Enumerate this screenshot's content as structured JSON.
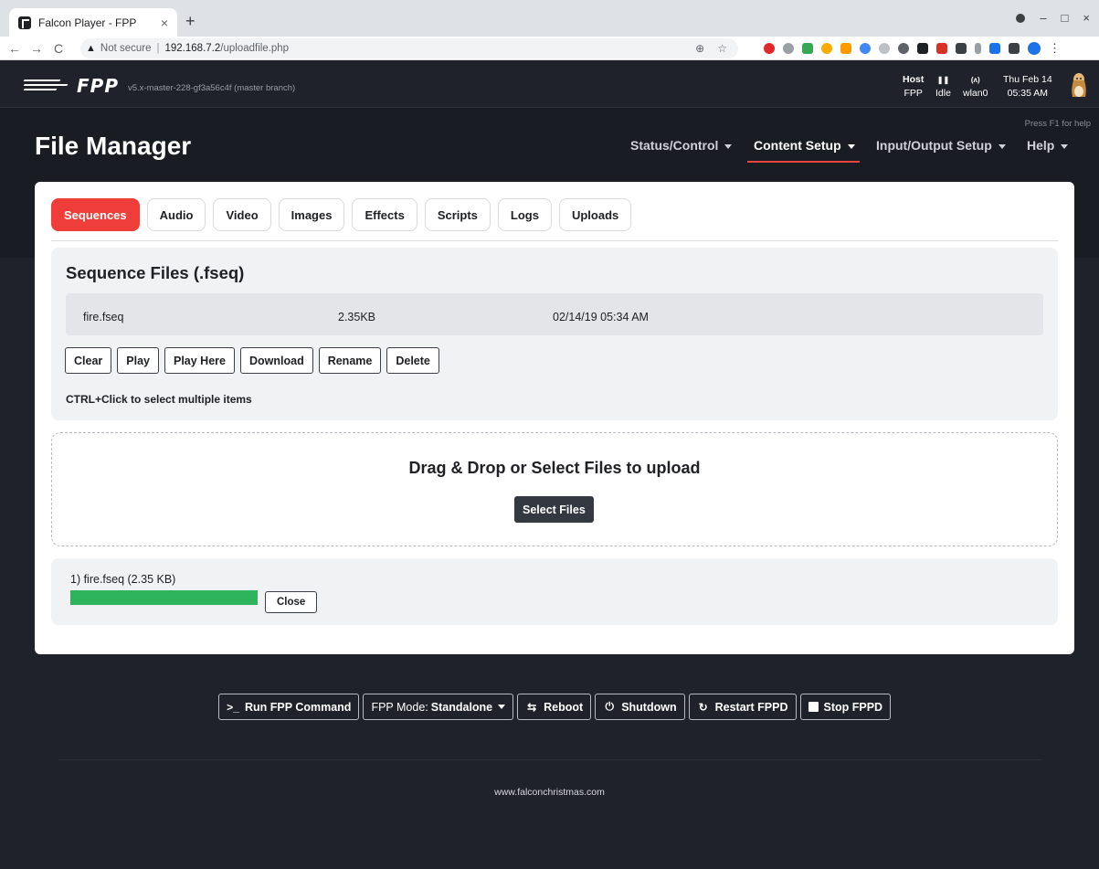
{
  "browser": {
    "tab_title": "Falcon Player - FPP",
    "tab_close": "×",
    "new_tab": "+",
    "security_label": "Not secure",
    "url_host": "192.168.7.2",
    "url_path": "/uploadfile.php",
    "nav_back": "←",
    "nav_forward": "→",
    "nav_reload": "C",
    "win_min": "–",
    "win_max": "□",
    "win_close": "×",
    "zoom_icon": "⊕",
    "bookmark_icon": "☆",
    "menu_icon": "⋮"
  },
  "fpp": {
    "logo_text": "FPP",
    "version": "v5.x-master-228-gf3a56c4f (master branch)",
    "status": {
      "host_label": "Host",
      "host_value": "FPP",
      "state_icon": "❚❚",
      "state_value": "Idle",
      "wifi_icon": "(ᴧ)",
      "wifi_value": "wlan0",
      "date": "Thu Feb 14",
      "time": "05:35 AM"
    },
    "help_hint": "Press F1 for help",
    "page_title": "File Manager",
    "nav": [
      "Status/Control",
      "Content Setup",
      "Input/Output Setup",
      "Help"
    ],
    "active_nav": "Content Setup"
  },
  "tabs": [
    "Sequences",
    "Audio",
    "Video",
    "Images",
    "Effects",
    "Scripts",
    "Logs",
    "Uploads"
  ],
  "active_tab": "Sequences",
  "sequence_panel": {
    "title": "Sequence Files (.fseq)",
    "files": [
      {
        "name": "fire.fseq",
        "size": "2.35KB",
        "date": "02/14/19 05:34 AM"
      }
    ],
    "actions": [
      "Clear",
      "Play",
      "Play Here",
      "Download",
      "Rename",
      "Delete"
    ],
    "hint": "CTRL+Click to select multiple items"
  },
  "dropzone": {
    "title": "Drag & Drop or Select Files to upload",
    "button": "Select Files"
  },
  "upload": {
    "item": "1) fire.fseq (2.35 KB)",
    "progress": 1.0,
    "close": "Close"
  },
  "footer": {
    "run_command": "Run FPP Command",
    "mode_label": "FPP Mode:",
    "mode_value": "Standalone",
    "reboot": "Reboot",
    "shutdown": "Shutdown",
    "restart": "Restart FPPD",
    "stop": "Stop FPPD",
    "link": "www.falconchristmas.com"
  },
  "colors": {
    "accent_red": "#ef3d3a",
    "progress_green": "#2db45d",
    "page_bg": "#20222b"
  }
}
